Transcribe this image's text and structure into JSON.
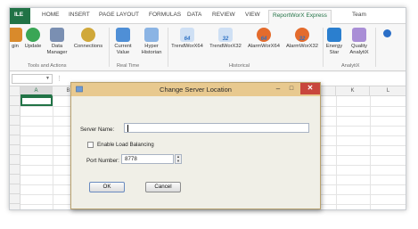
{
  "ribbon_tabs": [
    {
      "label": "ILE"
    },
    {
      "label": "HOME"
    },
    {
      "label": "INSERT"
    },
    {
      "label": "PAGE LAYOUT"
    },
    {
      "label": "FORMULAS"
    },
    {
      "label": "DATA"
    },
    {
      "label": "REVIEW"
    },
    {
      "label": "VIEW"
    },
    {
      "label": "ReportWorX Express"
    },
    {
      "label": "Team"
    }
  ],
  "ribbon": {
    "buttons": [
      {
        "label": "gin",
        "icon": "login-icon"
      },
      {
        "label": "Update",
        "icon": "refresh-icon"
      },
      {
        "label": "Data Manager",
        "icon": "data-manager-icon"
      },
      {
        "label": "Connections",
        "icon": "connections-icon"
      },
      {
        "label": "Current Value",
        "icon": "current-value-icon"
      },
      {
        "label": "Hyper Historian",
        "icon": "hyper-historian-icon"
      },
      {
        "label": "TrendWorX64",
        "icon": "trend-64-icon",
        "badge": "64"
      },
      {
        "label": "TrendWorX32",
        "icon": "trend-32-icon",
        "badge": "32"
      },
      {
        "label": "AlarmWorX64",
        "icon": "alarm-64-icon",
        "badge": "64"
      },
      {
        "label": "AlarmWorX32",
        "icon": "alarm-32-icon",
        "badge": "32"
      },
      {
        "label": "Energy Star",
        "icon": "energy-star-icon"
      },
      {
        "label": "Quality AnalytiX",
        "icon": "quality-icon"
      }
    ],
    "groups": {
      "tools": "Tools and Actions",
      "realtime": "Real Time",
      "historical": "Historical",
      "analytix": "AnalytiX"
    }
  },
  "columns": [
    "A",
    "B",
    "K",
    "L"
  ],
  "dialog": {
    "title": "Change Server Location",
    "server_name_label": "Server Name:",
    "server_name_value": "",
    "load_balancing_label": "Enable Load Balancing",
    "load_balancing_checked": false,
    "port_label": "Port Number:",
    "port_value": "8778",
    "ok_label": "OK",
    "cancel_label": "Cancel",
    "minimize_label": "–",
    "maximize_label": "□",
    "close_label": "✕"
  },
  "colors": {
    "excel_green": "#217346",
    "dialog_title": "#e8c98f",
    "close_red": "#c8463c"
  }
}
